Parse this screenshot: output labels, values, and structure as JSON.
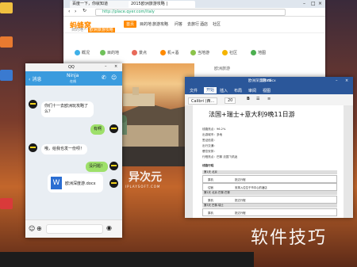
{
  "desktop": {
    "icons": [
      "folder-icon",
      "folder-icon",
      "app-icon",
      "app-icon"
    ]
  },
  "browser": {
    "tabs": [
      "百度一下，你就知道",
      "2015欧洲旅游攻略 |"
    ],
    "url": "http://place.qyer.com/italy",
    "logo": "蚂蜂窝",
    "logo_sub": "MAFENGWO",
    "nav": [
      "首页",
      "目的地",
      "旅游攻略",
      "问答",
      "去旅行",
      "酒店",
      "社区"
    ],
    "breadcrumb_label": "目的地",
    "breadcrumb_current": "欧洲旅游攻略",
    "categories": [
      {
        "label": "概况",
        "color": "#3fb0e8"
      },
      {
        "label": "目的地",
        "color": "#6fc15a"
      },
      {
        "label": "景点",
        "color": "#e86a5a"
      },
      {
        "label": "机+酒",
        "color": "#ff8a00"
      },
      {
        "label": "当地游",
        "color": "#8bc34a"
      },
      {
        "label": "社区",
        "color": "#f5b400"
      },
      {
        "label": "地图",
        "color": "#4caf50"
      }
    ],
    "section": "欧洲旅游"
  },
  "photo": {
    "wm_main": "异次元",
    "wm_sub": "IPLAYSOFT.COM"
  },
  "qq": {
    "app": "QQ",
    "back": "消息",
    "contact": "Ninja",
    "contact_sub": "在线",
    "messages": [
      {
        "text": "你们十一去欧洲玩攻略了么？",
        "dir": "in"
      },
      {
        "text": "有啊",
        "dir": "out"
      },
      {
        "text": "哦，给我也发一份呗！",
        "dir": "in"
      },
      {
        "text": "没问题！",
        "dir": "out"
      }
    ],
    "file_name": "欧洲深度游.docx"
  },
  "word": {
    "app": "Word",
    "doc_name": "欧洲深度游.docx",
    "tabs": [
      "文件",
      "开始",
      "插入",
      "布局",
      "审阅",
      "视图"
    ],
    "font": "Calibri (西...",
    "size": "20",
    "title": "法国+瑞士+意大利9晚11日游",
    "lines": [
      "线路亮点：96.2%",
      "出游城市：多地",
      "签证信息：",
      "出行交通：",
      "餐饮安排：",
      "行程亮点：巴黎 法国飞机返"
    ],
    "section": "线路行程",
    "rows": [
      {
        "head": "第1天  北京",
        "cells": [
          "乘机",
          "抵达行程"
        ]
      },
      {
        "head": "",
        "cells": [
          "住宿",
          "安排入住位于市中心的酒店"
        ]
      },
      {
        "head": "第2天  北京-巴黎-巴黎",
        "cells": [
          "乘机",
          "抵达行程"
        ]
      },
      {
        "head": "第3天  巴黎-瑞士",
        "cells": [
          "乘机",
          "抵达行程"
        ]
      }
    ]
  },
  "watermark": "软件技巧"
}
